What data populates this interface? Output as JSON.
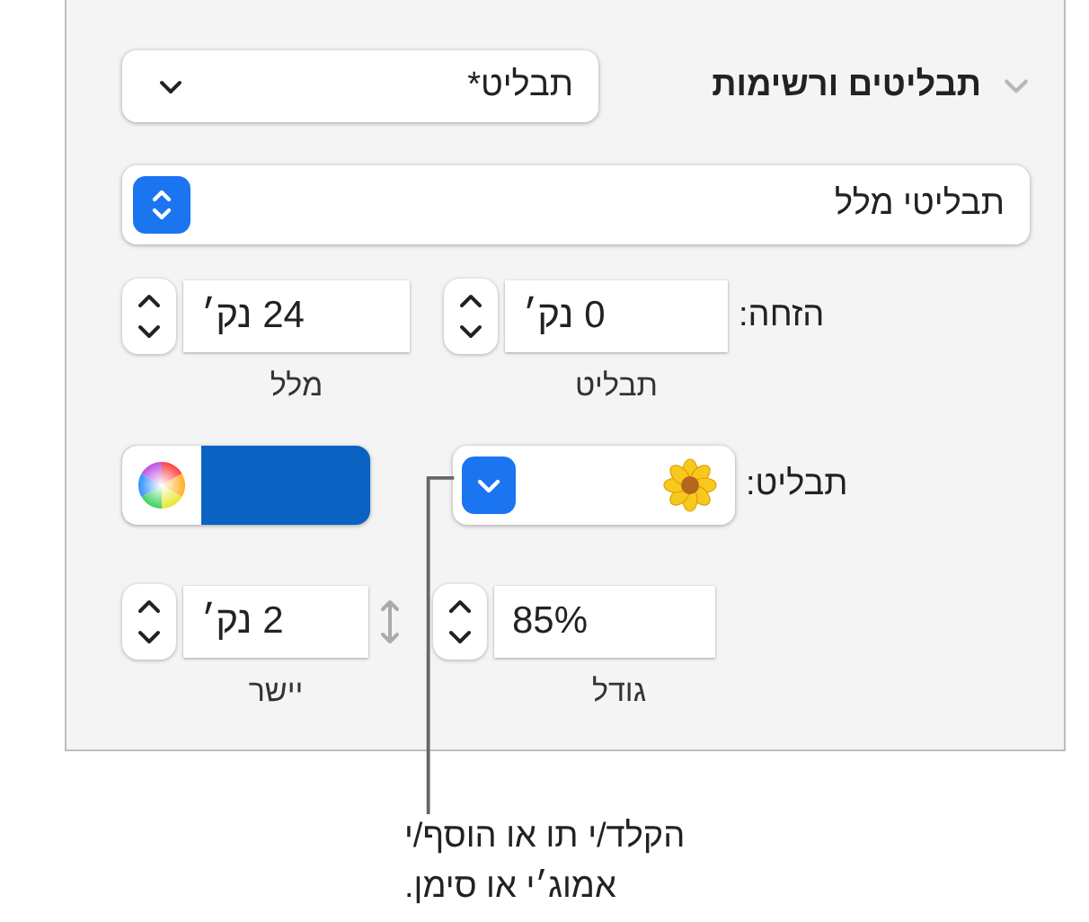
{
  "section": {
    "title": "תבליטים ורשימות",
    "expanded": true
  },
  "list_style_popup": {
    "value": "תבליט*"
  },
  "bullet_type_popup": {
    "value": "תבליטי מלל"
  },
  "indent": {
    "label": "הזחה:",
    "fields": [
      {
        "value": "0 נק׳",
        "caption": "תבליט"
      },
      {
        "value": "24 נק׳",
        "caption": "מלל"
      }
    ]
  },
  "bullet": {
    "label": "תבליט:"
  },
  "size_align": {
    "fields": [
      {
        "value": "85%",
        "caption": "גודל"
      },
      {
        "value": "2 נק׳",
        "caption": "יישר"
      }
    ]
  },
  "callout": {
    "lines": [
      "הקלד/י תו או הוסף/י",
      "אמוג׳י או סימן."
    ]
  }
}
